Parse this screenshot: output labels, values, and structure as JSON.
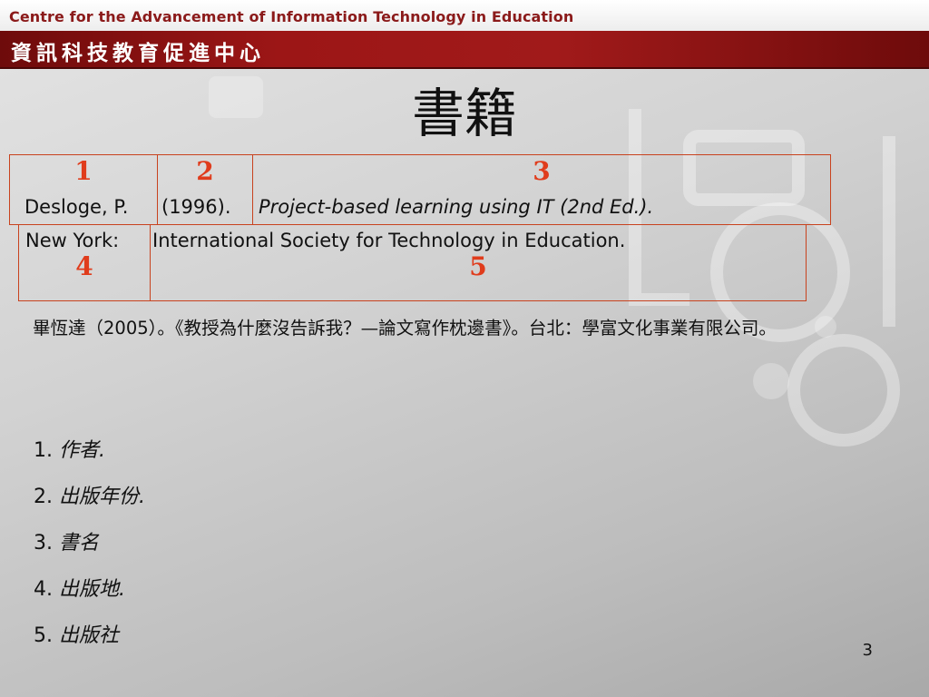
{
  "header": {
    "org_en": "Centre for the Advancement of Information Technology in Education",
    "org_zh": "資訊科技教育促進中心"
  },
  "slide": {
    "title": "書籍",
    "page_number": "3"
  },
  "citation": {
    "row1": {
      "num1": "1",
      "num2": "2",
      "num3": "3",
      "author": "Desloge, P.",
      "year": "(1996).",
      "book_title": "Project-based learning using IT (2nd Ed.)."
    },
    "row2": {
      "place": "New York:",
      "publisher": "International Society for Technology in Education.",
      "num4": "4",
      "num5": "5"
    }
  },
  "chinese_reference": "畢恆達（2005）。《教授為什麼沒告訴我？—論文寫作枕邊書》。台北：學富文化事業有限公司。",
  "legend": [
    {
      "num": "1.",
      "label": "作者."
    },
    {
      "num": "2.",
      "label": "出版年份."
    },
    {
      "num": "3.",
      "label": "書名"
    },
    {
      "num": "4.",
      "label": "出版地."
    },
    {
      "num": "5.",
      "label": "出版社"
    }
  ],
  "colors": {
    "header_red": "#9c1616",
    "number_red": "#e03c1c",
    "border": "#c8421e"
  }
}
